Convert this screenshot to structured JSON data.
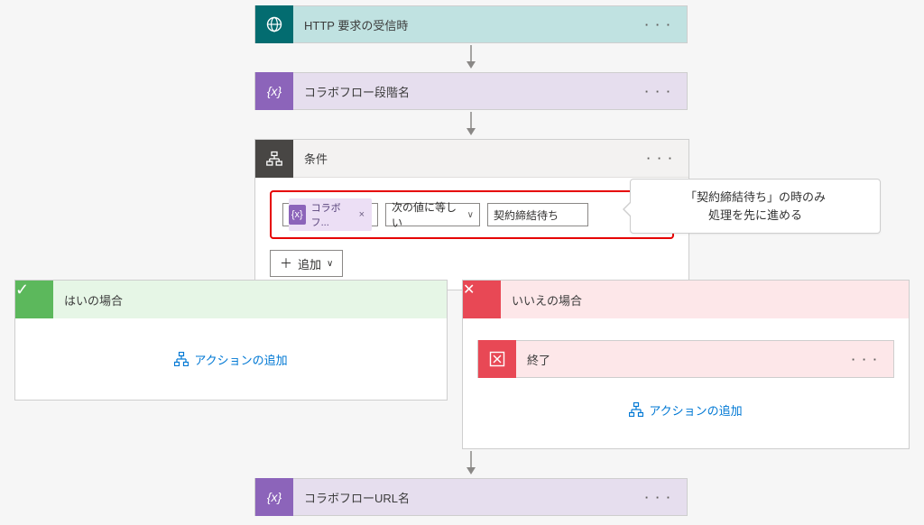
{
  "steps": {
    "http": {
      "title": "HTTP 要求の受信時"
    },
    "var1": {
      "title": "コラボフロー段階名"
    },
    "cond": {
      "title": "条件"
    },
    "end": {
      "title": "終了"
    },
    "var2": {
      "title": "コラボフローURL名"
    }
  },
  "condition": {
    "token_label": "コラボフ...",
    "operator": "次の値に等しい",
    "value": "契約締結待ち",
    "add_label": "追加"
  },
  "branches": {
    "yes_title": "はいの場合",
    "no_title": "いいえの場合",
    "add_action": "アクションの追加"
  },
  "callout": {
    "line1": "「契約締結待ち」の時のみ",
    "line2": "処理を先に進める"
  },
  "glyphs": {
    "variable": "{x}",
    "close_x": "×",
    "plus": "＋",
    "chevron": "∨",
    "no_x": "✕",
    "check": "✓",
    "ellipsis": "· · ·"
  }
}
